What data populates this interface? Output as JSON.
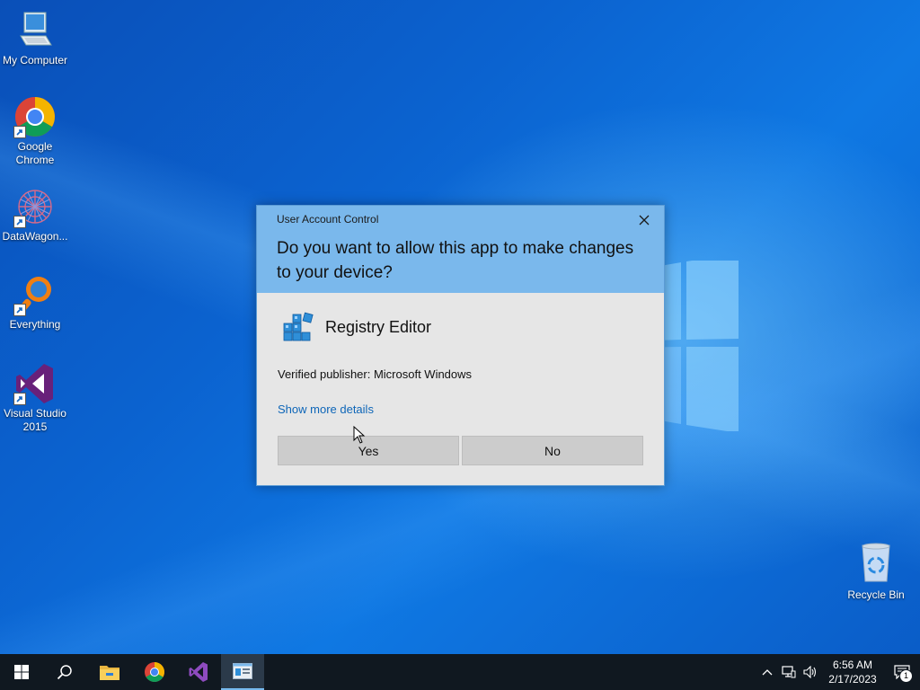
{
  "desktop": {
    "icons": [
      {
        "label": "My Computer"
      },
      {
        "label": "Google Chrome"
      },
      {
        "label": "DataWagon..."
      },
      {
        "label": "Everything"
      },
      {
        "label": "Visual Studio 2015"
      }
    ],
    "recycle_bin": {
      "label": "Recycle Bin"
    }
  },
  "uac": {
    "title": "User Account Control",
    "question": "Do you want to allow this app to make changes to your device?",
    "app_name": "Registry Editor",
    "publisher": "Verified publisher: Microsoft Windows",
    "details_link": "Show more details",
    "yes_label": "Yes",
    "no_label": "No"
  },
  "taskbar": {
    "items": [
      {
        "icon": "windows-start-icon"
      },
      {
        "icon": "search-icon"
      },
      {
        "icon": "file-explorer-icon"
      },
      {
        "icon": "chrome-icon"
      },
      {
        "icon": "visual-studio-icon"
      },
      {
        "icon": "uac-app-icon",
        "active": true
      }
    ],
    "clock": {
      "time": "6:56 AM",
      "date": "2/17/2023"
    },
    "notifications_count": "1"
  },
  "colors": {
    "uac_header": "#7ab8ec",
    "link": "#0e66b8",
    "taskbar": "#101820"
  }
}
